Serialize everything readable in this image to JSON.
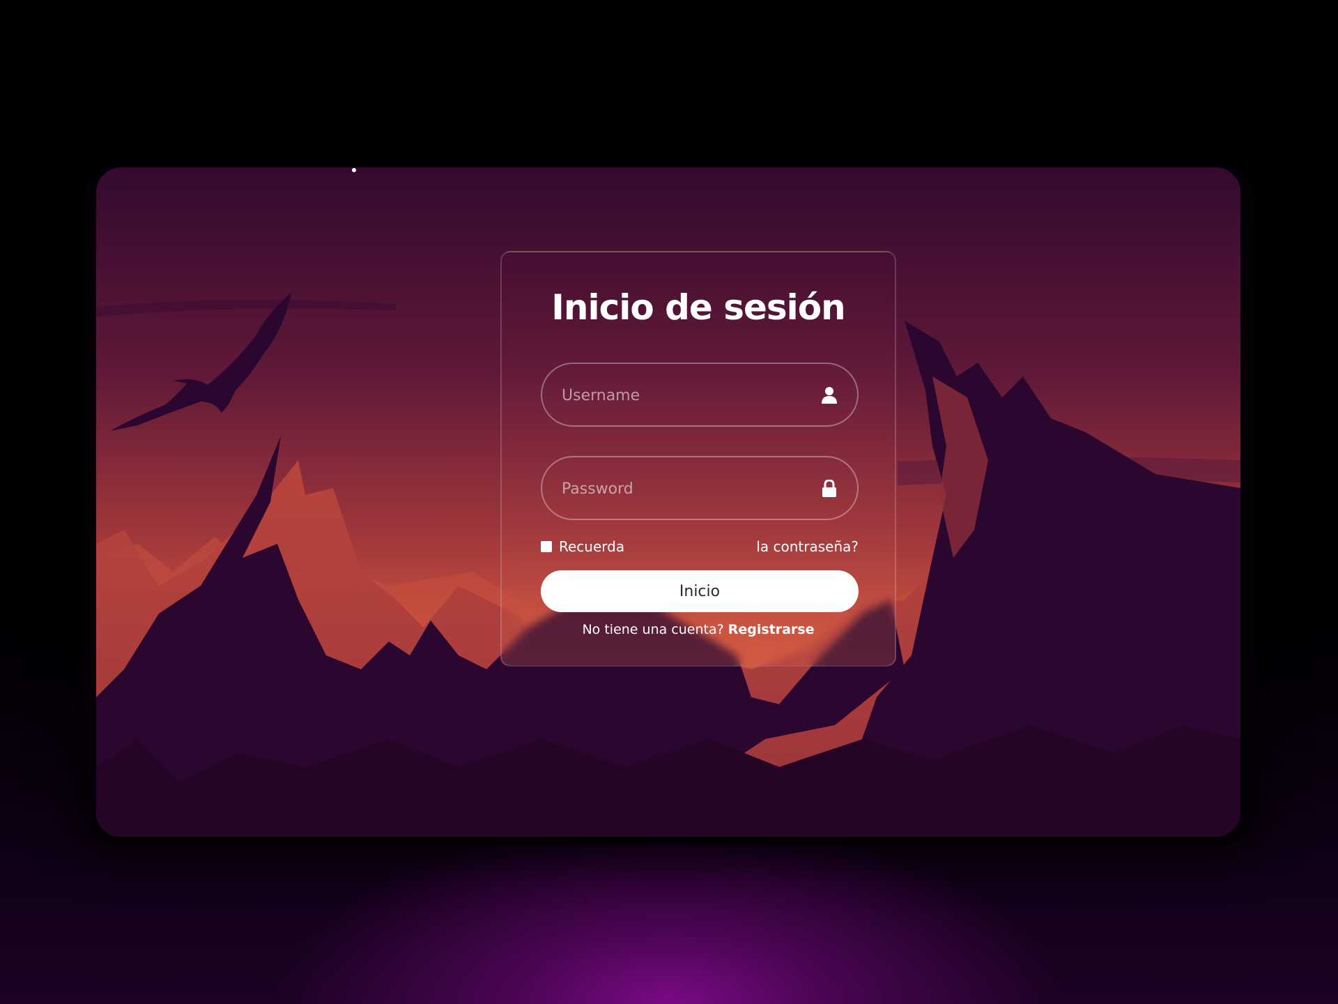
{
  "login": {
    "title": "Inicio de sesión",
    "username_placeholder": "Username",
    "password_placeholder": "Password",
    "remember_label": "Recuerda",
    "forgot_label": "la contraseña?",
    "submit_label": "Inicio",
    "register_prompt": "No tiene una cuenta?",
    "register_link": "Registrarse"
  },
  "icons": {
    "username": "user-icon",
    "password": "lock-icon"
  },
  "colors": {
    "sky_top": "#330a2e",
    "sky_horizon": "#e5603e",
    "mountain_dark": "#2b0730",
    "mountain_red": "#b8443c",
    "button_bg": "#ffffff",
    "glow": "#7a0a86"
  }
}
